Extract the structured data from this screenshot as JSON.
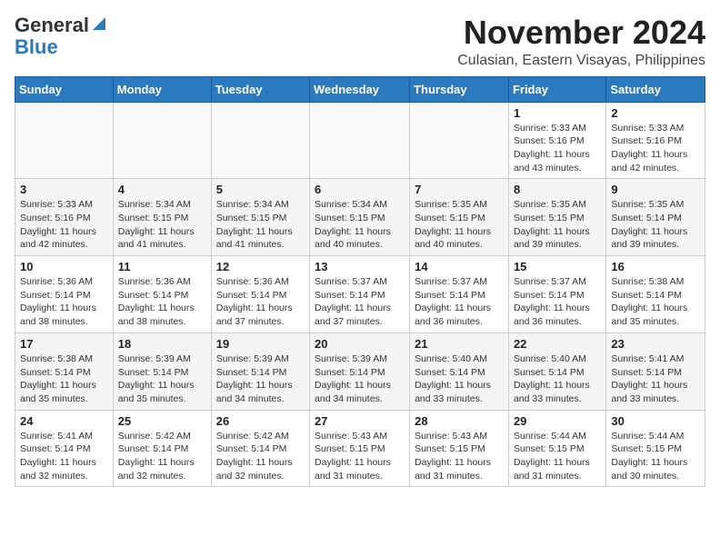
{
  "header": {
    "logo_line1": "General",
    "logo_line2": "Blue",
    "month_year": "November 2024",
    "location": "Culasian, Eastern Visayas, Philippines"
  },
  "weekdays": [
    "Sunday",
    "Monday",
    "Tuesday",
    "Wednesday",
    "Thursday",
    "Friday",
    "Saturday"
  ],
  "weeks": [
    [
      {
        "day": "",
        "info": ""
      },
      {
        "day": "",
        "info": ""
      },
      {
        "day": "",
        "info": ""
      },
      {
        "day": "",
        "info": ""
      },
      {
        "day": "",
        "info": ""
      },
      {
        "day": "1",
        "info": "Sunrise: 5:33 AM\nSunset: 5:16 PM\nDaylight: 11 hours\nand 43 minutes."
      },
      {
        "day": "2",
        "info": "Sunrise: 5:33 AM\nSunset: 5:16 PM\nDaylight: 11 hours\nand 42 minutes."
      }
    ],
    [
      {
        "day": "3",
        "info": "Sunrise: 5:33 AM\nSunset: 5:16 PM\nDaylight: 11 hours\nand 42 minutes."
      },
      {
        "day": "4",
        "info": "Sunrise: 5:34 AM\nSunset: 5:15 PM\nDaylight: 11 hours\nand 41 minutes."
      },
      {
        "day": "5",
        "info": "Sunrise: 5:34 AM\nSunset: 5:15 PM\nDaylight: 11 hours\nand 41 minutes."
      },
      {
        "day": "6",
        "info": "Sunrise: 5:34 AM\nSunset: 5:15 PM\nDaylight: 11 hours\nand 40 minutes."
      },
      {
        "day": "7",
        "info": "Sunrise: 5:35 AM\nSunset: 5:15 PM\nDaylight: 11 hours\nand 40 minutes."
      },
      {
        "day": "8",
        "info": "Sunrise: 5:35 AM\nSunset: 5:15 PM\nDaylight: 11 hours\nand 39 minutes."
      },
      {
        "day": "9",
        "info": "Sunrise: 5:35 AM\nSunset: 5:14 PM\nDaylight: 11 hours\nand 39 minutes."
      }
    ],
    [
      {
        "day": "10",
        "info": "Sunrise: 5:36 AM\nSunset: 5:14 PM\nDaylight: 11 hours\nand 38 minutes."
      },
      {
        "day": "11",
        "info": "Sunrise: 5:36 AM\nSunset: 5:14 PM\nDaylight: 11 hours\nand 38 minutes."
      },
      {
        "day": "12",
        "info": "Sunrise: 5:36 AM\nSunset: 5:14 PM\nDaylight: 11 hours\nand 37 minutes."
      },
      {
        "day": "13",
        "info": "Sunrise: 5:37 AM\nSunset: 5:14 PM\nDaylight: 11 hours\nand 37 minutes."
      },
      {
        "day": "14",
        "info": "Sunrise: 5:37 AM\nSunset: 5:14 PM\nDaylight: 11 hours\nand 36 minutes."
      },
      {
        "day": "15",
        "info": "Sunrise: 5:37 AM\nSunset: 5:14 PM\nDaylight: 11 hours\nand 36 minutes."
      },
      {
        "day": "16",
        "info": "Sunrise: 5:38 AM\nSunset: 5:14 PM\nDaylight: 11 hours\nand 35 minutes."
      }
    ],
    [
      {
        "day": "17",
        "info": "Sunrise: 5:38 AM\nSunset: 5:14 PM\nDaylight: 11 hours\nand 35 minutes."
      },
      {
        "day": "18",
        "info": "Sunrise: 5:39 AM\nSunset: 5:14 PM\nDaylight: 11 hours\nand 35 minutes."
      },
      {
        "day": "19",
        "info": "Sunrise: 5:39 AM\nSunset: 5:14 PM\nDaylight: 11 hours\nand 34 minutes."
      },
      {
        "day": "20",
        "info": "Sunrise: 5:39 AM\nSunset: 5:14 PM\nDaylight: 11 hours\nand 34 minutes."
      },
      {
        "day": "21",
        "info": "Sunrise: 5:40 AM\nSunset: 5:14 PM\nDaylight: 11 hours\nand 33 minutes."
      },
      {
        "day": "22",
        "info": "Sunrise: 5:40 AM\nSunset: 5:14 PM\nDaylight: 11 hours\nand 33 minutes."
      },
      {
        "day": "23",
        "info": "Sunrise: 5:41 AM\nSunset: 5:14 PM\nDaylight: 11 hours\nand 33 minutes."
      }
    ],
    [
      {
        "day": "24",
        "info": "Sunrise: 5:41 AM\nSunset: 5:14 PM\nDaylight: 11 hours\nand 32 minutes."
      },
      {
        "day": "25",
        "info": "Sunrise: 5:42 AM\nSunset: 5:14 PM\nDaylight: 11 hours\nand 32 minutes."
      },
      {
        "day": "26",
        "info": "Sunrise: 5:42 AM\nSunset: 5:14 PM\nDaylight: 11 hours\nand 32 minutes."
      },
      {
        "day": "27",
        "info": "Sunrise: 5:43 AM\nSunset: 5:15 PM\nDaylight: 11 hours\nand 31 minutes."
      },
      {
        "day": "28",
        "info": "Sunrise: 5:43 AM\nSunset: 5:15 PM\nDaylight: 11 hours\nand 31 minutes."
      },
      {
        "day": "29",
        "info": "Sunrise: 5:44 AM\nSunset: 5:15 PM\nDaylight: 11 hours\nand 31 minutes."
      },
      {
        "day": "30",
        "info": "Sunrise: 5:44 AM\nSunset: 5:15 PM\nDaylight: 11 hours\nand 30 minutes."
      }
    ]
  ]
}
